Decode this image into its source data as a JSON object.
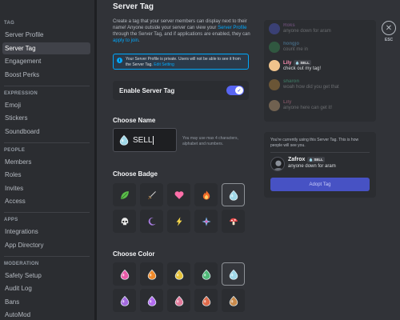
{
  "sidebar": {
    "sections": [
      {
        "heading": "TAG",
        "items": [
          {
            "label": "Server Profile"
          },
          {
            "label": "Server Tag",
            "active": true
          },
          {
            "label": "Engagement"
          },
          {
            "label": "Boost Perks"
          }
        ]
      },
      {
        "heading": "EXPRESSION",
        "items": [
          {
            "label": "Emoji"
          },
          {
            "label": "Stickers"
          },
          {
            "label": "Soundboard"
          }
        ]
      },
      {
        "heading": "PEOPLE",
        "items": [
          {
            "label": "Members"
          },
          {
            "label": "Roles"
          },
          {
            "label": "Invites"
          },
          {
            "label": "Access"
          }
        ]
      },
      {
        "heading": "APPS",
        "items": [
          {
            "label": "Integrations"
          },
          {
            "label": "App Directory"
          }
        ]
      },
      {
        "heading": "MODERATION",
        "items": [
          {
            "label": "Safety Setup"
          },
          {
            "label": "Audit Log"
          },
          {
            "label": "Bans"
          },
          {
            "label": "AutoMod"
          }
        ]
      }
    ]
  },
  "main": {
    "title": "Server Tag",
    "intro_1": "Create a tag that your server members can display next to their name! Anyone outside your server can view your ",
    "intro_link_1": "Server Profile",
    "intro_2": " through the Server Tag, and if applications are enabled, they can ",
    "intro_link_2": "apply to join",
    "intro_3": ".",
    "info_text": "Your Server Profile is private. Users will not be able to see it from the Server Tag. ",
    "info_link": "Edit Setting",
    "enable_label": "Enable Server Tag",
    "enable_on": true,
    "choose_name_label": "Choose Name",
    "name_value": "SELL",
    "name_hint": "You may use max 4 characters, alphabet and numbers.",
    "choose_badge_label": "Choose Badge",
    "badges": [
      {
        "icon": "leaf-icon",
        "color": "#5bbd4a"
      },
      {
        "icon": "sword-icon",
        "color": "#c9a36b"
      },
      {
        "icon": "heart-icon",
        "color": "#ff6fa9"
      },
      {
        "icon": "flame-icon",
        "color": "#f26b2a"
      },
      {
        "icon": "water-drop-icon",
        "color": "#9fd8e8",
        "selected": true
      },
      {
        "icon": "skull-icon",
        "color": "#e8e8e8"
      },
      {
        "icon": "moon-icon",
        "color": "#a77ce0"
      },
      {
        "icon": "lightning-icon",
        "color": "#f6d64a"
      },
      {
        "icon": "sparkle-icon",
        "color": "#7bb6f0"
      },
      {
        "icon": "mushroom-icon",
        "color": "#e84a4a"
      }
    ],
    "choose_color_label": "Choose Color",
    "colors": [
      {
        "color": "#e85aa8"
      },
      {
        "color": "#f08a2a"
      },
      {
        "color": "#e6c23a"
      },
      {
        "color": "#4fb878"
      },
      {
        "color": "#9fd8e8",
        "selected": true
      },
      {
        "color": "#a46ae0"
      },
      {
        "color": "#b36cf0"
      },
      {
        "color": "#e37b9b"
      },
      {
        "color": "#e06a4a"
      },
      {
        "color": "#c98a4a"
      }
    ]
  },
  "preview": {
    "messages": [
      {
        "name": "Roks",
        "msg": "anyone down for aram",
        "name_color": "#c27cd6",
        "avatar": "#5865f2",
        "dim": true
      },
      {
        "name": "hongjo",
        "msg": "count me in",
        "name_color": "#6fc7ff",
        "avatar": "#3ba55c",
        "dim": true
      },
      {
        "name": "Lily",
        "msg": "check out my tag!",
        "name_color": "#ff8fb3",
        "avatar": "#f0c38c",
        "tag": "SELL",
        "dim": false
      },
      {
        "name": "sharon",
        "msg": "woah how did you get that",
        "name_color": "#55d7a0",
        "avatar": "#e0a040",
        "dim": true
      },
      {
        "name": "Lily",
        "msg": "anyone here can get it!",
        "name_color": "#ff8fb3",
        "avatar": "#f0c38c",
        "dim": true
      }
    ]
  },
  "preview2": {
    "text": "You're currently using this Server Tag. This is how people will see you.",
    "user_name": "Zafrox",
    "tag": "SELL",
    "msg": "anyone down for aram",
    "button": "Adopt Tag"
  },
  "close": {
    "icon": "close-icon",
    "label": "ESC"
  },
  "accent": "#5865f2"
}
